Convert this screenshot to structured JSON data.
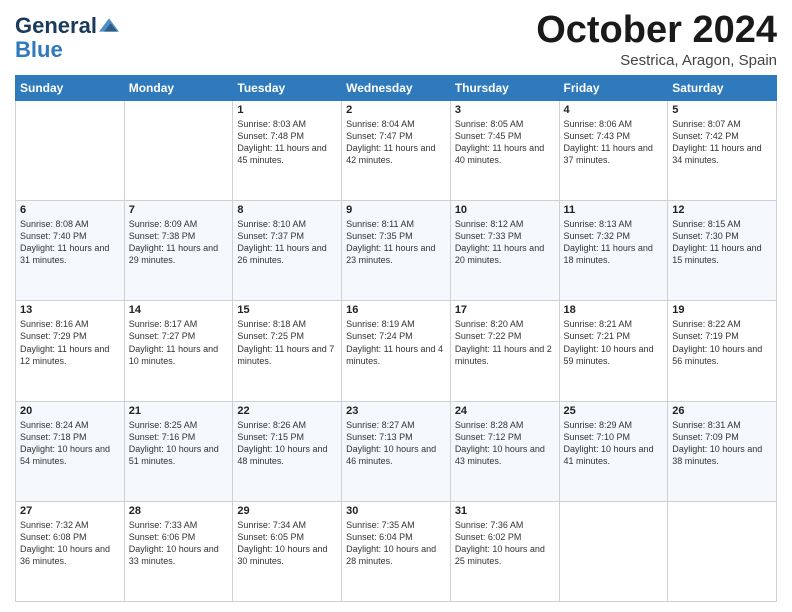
{
  "logo": {
    "line1": "General",
    "line2": "Blue"
  },
  "header": {
    "month": "October 2024",
    "location": "Sestrica, Aragon, Spain"
  },
  "weekdays": [
    "Sunday",
    "Monday",
    "Tuesday",
    "Wednesday",
    "Thursday",
    "Friday",
    "Saturday"
  ],
  "weeks": [
    [
      {
        "day": "",
        "sunrise": "",
        "sunset": "",
        "daylight": ""
      },
      {
        "day": "",
        "sunrise": "",
        "sunset": "",
        "daylight": ""
      },
      {
        "day": "1",
        "sunrise": "Sunrise: 8:03 AM",
        "sunset": "Sunset: 7:48 PM",
        "daylight": "Daylight: 11 hours and 45 minutes."
      },
      {
        "day": "2",
        "sunrise": "Sunrise: 8:04 AM",
        "sunset": "Sunset: 7:47 PM",
        "daylight": "Daylight: 11 hours and 42 minutes."
      },
      {
        "day": "3",
        "sunrise": "Sunrise: 8:05 AM",
        "sunset": "Sunset: 7:45 PM",
        "daylight": "Daylight: 11 hours and 40 minutes."
      },
      {
        "day": "4",
        "sunrise": "Sunrise: 8:06 AM",
        "sunset": "Sunset: 7:43 PM",
        "daylight": "Daylight: 11 hours and 37 minutes."
      },
      {
        "day": "5",
        "sunrise": "Sunrise: 8:07 AM",
        "sunset": "Sunset: 7:42 PM",
        "daylight": "Daylight: 11 hours and 34 minutes."
      }
    ],
    [
      {
        "day": "6",
        "sunrise": "Sunrise: 8:08 AM",
        "sunset": "Sunset: 7:40 PM",
        "daylight": "Daylight: 11 hours and 31 minutes."
      },
      {
        "day": "7",
        "sunrise": "Sunrise: 8:09 AM",
        "sunset": "Sunset: 7:38 PM",
        "daylight": "Daylight: 11 hours and 29 minutes."
      },
      {
        "day": "8",
        "sunrise": "Sunrise: 8:10 AM",
        "sunset": "Sunset: 7:37 PM",
        "daylight": "Daylight: 11 hours and 26 minutes."
      },
      {
        "day": "9",
        "sunrise": "Sunrise: 8:11 AM",
        "sunset": "Sunset: 7:35 PM",
        "daylight": "Daylight: 11 hours and 23 minutes."
      },
      {
        "day": "10",
        "sunrise": "Sunrise: 8:12 AM",
        "sunset": "Sunset: 7:33 PM",
        "daylight": "Daylight: 11 hours and 20 minutes."
      },
      {
        "day": "11",
        "sunrise": "Sunrise: 8:13 AM",
        "sunset": "Sunset: 7:32 PM",
        "daylight": "Daylight: 11 hours and 18 minutes."
      },
      {
        "day": "12",
        "sunrise": "Sunrise: 8:15 AM",
        "sunset": "Sunset: 7:30 PM",
        "daylight": "Daylight: 11 hours and 15 minutes."
      }
    ],
    [
      {
        "day": "13",
        "sunrise": "Sunrise: 8:16 AM",
        "sunset": "Sunset: 7:29 PM",
        "daylight": "Daylight: 11 hours and 12 minutes."
      },
      {
        "day": "14",
        "sunrise": "Sunrise: 8:17 AM",
        "sunset": "Sunset: 7:27 PM",
        "daylight": "Daylight: 11 hours and 10 minutes."
      },
      {
        "day": "15",
        "sunrise": "Sunrise: 8:18 AM",
        "sunset": "Sunset: 7:25 PM",
        "daylight": "Daylight: 11 hours and 7 minutes."
      },
      {
        "day": "16",
        "sunrise": "Sunrise: 8:19 AM",
        "sunset": "Sunset: 7:24 PM",
        "daylight": "Daylight: 11 hours and 4 minutes."
      },
      {
        "day": "17",
        "sunrise": "Sunrise: 8:20 AM",
        "sunset": "Sunset: 7:22 PM",
        "daylight": "Daylight: 11 hours and 2 minutes."
      },
      {
        "day": "18",
        "sunrise": "Sunrise: 8:21 AM",
        "sunset": "Sunset: 7:21 PM",
        "daylight": "Daylight: 10 hours and 59 minutes."
      },
      {
        "day": "19",
        "sunrise": "Sunrise: 8:22 AM",
        "sunset": "Sunset: 7:19 PM",
        "daylight": "Daylight: 10 hours and 56 minutes."
      }
    ],
    [
      {
        "day": "20",
        "sunrise": "Sunrise: 8:24 AM",
        "sunset": "Sunset: 7:18 PM",
        "daylight": "Daylight: 10 hours and 54 minutes."
      },
      {
        "day": "21",
        "sunrise": "Sunrise: 8:25 AM",
        "sunset": "Sunset: 7:16 PM",
        "daylight": "Daylight: 10 hours and 51 minutes."
      },
      {
        "day": "22",
        "sunrise": "Sunrise: 8:26 AM",
        "sunset": "Sunset: 7:15 PM",
        "daylight": "Daylight: 10 hours and 48 minutes."
      },
      {
        "day": "23",
        "sunrise": "Sunrise: 8:27 AM",
        "sunset": "Sunset: 7:13 PM",
        "daylight": "Daylight: 10 hours and 46 minutes."
      },
      {
        "day": "24",
        "sunrise": "Sunrise: 8:28 AM",
        "sunset": "Sunset: 7:12 PM",
        "daylight": "Daylight: 10 hours and 43 minutes."
      },
      {
        "day": "25",
        "sunrise": "Sunrise: 8:29 AM",
        "sunset": "Sunset: 7:10 PM",
        "daylight": "Daylight: 10 hours and 41 minutes."
      },
      {
        "day": "26",
        "sunrise": "Sunrise: 8:31 AM",
        "sunset": "Sunset: 7:09 PM",
        "daylight": "Daylight: 10 hours and 38 minutes."
      }
    ],
    [
      {
        "day": "27",
        "sunrise": "Sunrise: 7:32 AM",
        "sunset": "Sunset: 6:08 PM",
        "daylight": "Daylight: 10 hours and 36 minutes."
      },
      {
        "day": "28",
        "sunrise": "Sunrise: 7:33 AM",
        "sunset": "Sunset: 6:06 PM",
        "daylight": "Daylight: 10 hours and 33 minutes."
      },
      {
        "day": "29",
        "sunrise": "Sunrise: 7:34 AM",
        "sunset": "Sunset: 6:05 PM",
        "daylight": "Daylight: 10 hours and 30 minutes."
      },
      {
        "day": "30",
        "sunrise": "Sunrise: 7:35 AM",
        "sunset": "Sunset: 6:04 PM",
        "daylight": "Daylight: 10 hours and 28 minutes."
      },
      {
        "day": "31",
        "sunrise": "Sunrise: 7:36 AM",
        "sunset": "Sunset: 6:02 PM",
        "daylight": "Daylight: 10 hours and 25 minutes."
      },
      {
        "day": "",
        "sunrise": "",
        "sunset": "",
        "daylight": ""
      },
      {
        "day": "",
        "sunrise": "",
        "sunset": "",
        "daylight": ""
      }
    ]
  ]
}
